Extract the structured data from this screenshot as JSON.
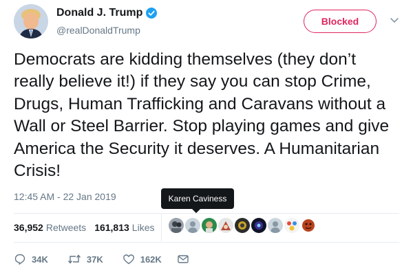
{
  "author": {
    "display_name": "Donald J. Trump",
    "handle": "@realDonaldTrump",
    "avatar_icon": "profile-photo"
  },
  "follow_button": {
    "label": "Blocked",
    "color": "#e0245e"
  },
  "tweet": {
    "text": "Democrats are kidding themselves (they don’t really believe it!) if they say you can stop Crime, Drugs, Human Trafficking and Caravans without a Wall or Steel Barrier. Stop playing games and give America the Security it deserves. A Humanitarian Crisis!",
    "timestamp": "12:45 AM - 22 Jan 2019"
  },
  "tooltip": {
    "text": "Karen Caviness"
  },
  "stats": {
    "retweets_count": "36,952",
    "retweets_label": "Retweets",
    "likes_count": "161,813",
    "likes_label": "Likes"
  },
  "actions": {
    "reply_count": "34K",
    "retweet_count": "37K",
    "like_count": "162K"
  },
  "colors": {
    "text": "#14171a",
    "secondary": "#657786",
    "verified": "#1da1f2",
    "divider": "#e6ecf0"
  }
}
